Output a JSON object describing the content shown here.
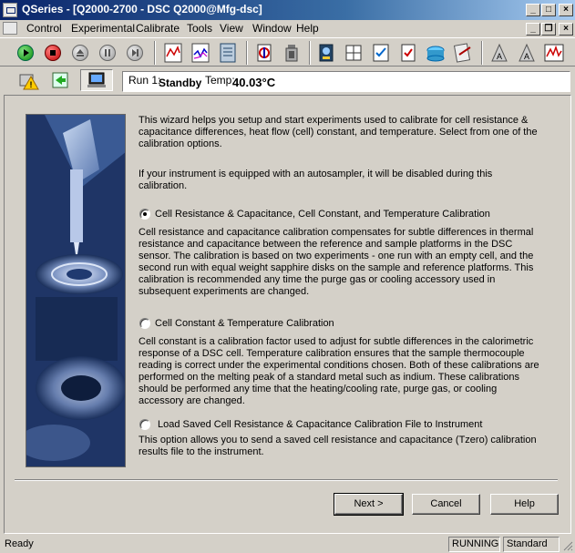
{
  "window": {
    "title": "QSeries - [Q2000-2700 - DSC Q2000@Mfg-dsc]",
    "minimize": "_",
    "maximize": "□",
    "close": "×"
  },
  "menu": {
    "items": [
      "Control",
      "Experimental",
      "Calibrate",
      "Tools",
      "View",
      "Window",
      "Help"
    ],
    "mdi_minimize": "_",
    "mdi_restore": "❐",
    "mdi_close": "×"
  },
  "toolbar": {
    "icons": [
      "start-icon",
      "stop-icon",
      "eject-icon",
      "pause-icon",
      "skip-icon",
      "view-signals-icon",
      "plot-icon",
      "instrument-log-icon",
      "calibration-icon",
      "cell-icon",
      "autosampler-icon",
      "grid-icon",
      "checklist-icon",
      "verify-icon",
      "data-folder-icon",
      "notes-icon",
      "triangle-flag-icon",
      "triangle-flag-2-icon",
      "graph-icon"
    ]
  },
  "status": {
    "run_label": "Run 1:",
    "run_value": "Standby",
    "temp_label": "Temp:",
    "temp_value": "40.03°C"
  },
  "wizard": {
    "intro": "This wizard helps you setup and start experiments used to calibrate for cell resistance & capacitance differences, heat flow (cell) constant, and temperature.  Select from one of the calibration options.",
    "autosampler_note": "If your instrument is equipped with an autosampler, it will be disabled during this calibration.",
    "options": [
      {
        "label": "Cell Resistance & Capacitance, Cell Constant, and Temperature Calibration",
        "checked": true,
        "description": "Cell resistance and capacitance calibration compensates for subtle differences in thermal resistance and capacitance between the reference and sample platforms in the DSC sensor.  The calibration is based on two experiments - one run with an empty cell, and the second run with equal weight sapphire disks on the sample and reference platforms.  This calibration is recommended any time the purge gas or cooling accessory used in subsequent experiments are changed."
      },
      {
        "label": "Cell Constant & Temperature Calibration",
        "checked": false,
        "description": "Cell constant is a calibration factor used to adjust for subtle differences in the calorimetric response of a DSC cell.  Temperature calibration ensures that the sample thermocouple reading is correct under the experimental conditions chosen. Both of these calibrations are performed on the melting peak of a standard metal such as indium.  These calibrations should be performed any time that the heating/cooling rate, purge gas, or cooling accessory are changed."
      },
      {
        "label": "Load Saved Cell Resistance & Capacitance Calibration File to Instrument",
        "checked": false,
        "description": "This option allows you to send a saved cell resistance and capacitance (Tzero) calibration results file to the instrument."
      }
    ],
    "buttons": {
      "next": "Next >",
      "cancel": "Cancel",
      "help": "Help"
    }
  },
  "statusbar": {
    "ready": "Ready",
    "running": "RUNNING",
    "mode": "Standard"
  }
}
